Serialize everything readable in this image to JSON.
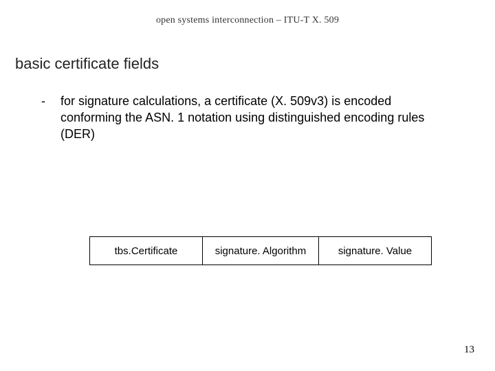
{
  "header": "open systems interconnection – ITU-T X. 509",
  "title": "basic certificate fields",
  "bullet": {
    "dash": "-",
    "text": "for signature calculations, a certificate (X. 509v3) is encoded conforming the ASN. 1 notation using distinguished encoding rules (DER)"
  },
  "table": {
    "cells": [
      "tbs.Certificate",
      "signature. Algorithm",
      "signature. Value"
    ]
  },
  "page_number": "13"
}
